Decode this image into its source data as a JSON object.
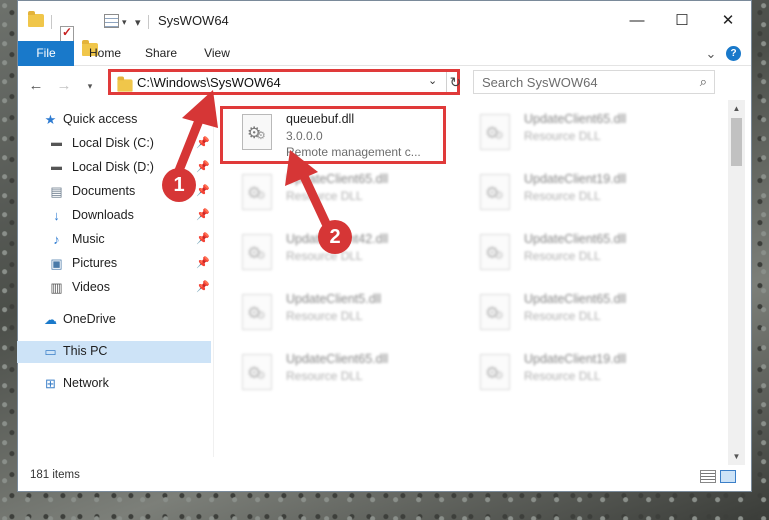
{
  "window": {
    "title": "SysWOW64",
    "controls": {
      "minimize": "—",
      "maximize": "☐",
      "close": "✕"
    }
  },
  "ribbon": {
    "tabs": [
      "File",
      "Home",
      "Share",
      "View"
    ],
    "expand": "⌄",
    "help": "?"
  },
  "address": {
    "path": "C:\\Windows\\SysWOW64",
    "search_placeholder": "Search SysWOW64"
  },
  "navigation": {
    "items": [
      {
        "label": "Quick access",
        "icon": "star-icon",
        "pinned": false
      },
      {
        "label": "Local Disk (C:)",
        "icon": "drive-icon",
        "pinned": true
      },
      {
        "label": "Local Disk (D:)",
        "icon": "drive-icon",
        "pinned": true
      },
      {
        "label": "Documents",
        "icon": "documents-icon",
        "pinned": true
      },
      {
        "label": "Downloads",
        "icon": "download-icon",
        "pinned": true
      },
      {
        "label": "Music",
        "icon": "music-icon",
        "pinned": true
      },
      {
        "label": "Pictures",
        "icon": "pictures-icon",
        "pinned": true
      },
      {
        "label": "Videos",
        "icon": "videos-icon",
        "pinned": true
      },
      {
        "label": "OneDrive",
        "icon": "cloud-icon",
        "pinned": false
      },
      {
        "label": "This PC",
        "icon": "computer-icon",
        "pinned": false,
        "selected": true
      },
      {
        "label": "Network",
        "icon": "network-icon",
        "pinned": false
      }
    ]
  },
  "files": {
    "focused": {
      "name": "queuebuf.dll",
      "version": "3.0.0.0",
      "description": "Remote management c..."
    },
    "background": [
      {
        "name": "UpdateClient65.dll",
        "type": "Resource DLL"
      },
      {
        "name": "UpdateClient65.dll",
        "type": "Resource DLL"
      },
      {
        "name": "UpdateClient19.dll",
        "type": "Resource DLL"
      },
      {
        "name": "UpdateClient42.dll",
        "type": "Resource DLL"
      },
      {
        "name": "UpdateClient65.dll",
        "type": "Resource DLL"
      },
      {
        "name": "UpdateClient5.dll",
        "type": "Resource DLL"
      },
      {
        "name": "UpdateClient65.dll",
        "type": "Resource DLL"
      },
      {
        "name": "UpdateClient65.dll",
        "type": "Resource DLL"
      },
      {
        "name": "UpdateClient19.dll",
        "type": "Resource DLL"
      }
    ]
  },
  "status": {
    "item_count": "181 items"
  },
  "annotations": {
    "step1": "1",
    "step2": "2",
    "color": "#d63636"
  },
  "colors": {
    "accent": "#1979ca",
    "highlight": "#e03a3a",
    "selected_nav": "#cde3f7"
  }
}
